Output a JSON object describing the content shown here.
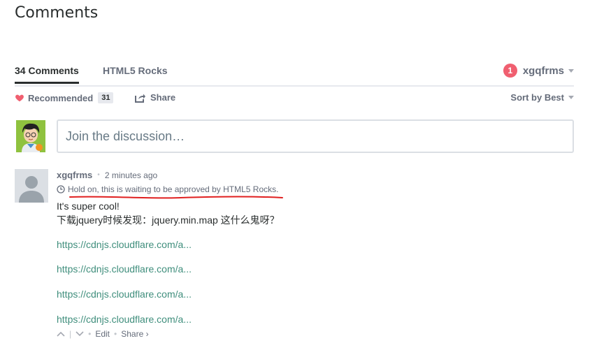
{
  "page": {
    "title": "Comments"
  },
  "nav": {
    "comments_tab": "34 Comments",
    "site_tab": "HTML5 Rocks",
    "notification_count": "1",
    "username": "xgqfrms"
  },
  "actions": {
    "recommend_label": "Recommended",
    "recommend_count": "31",
    "share_label": "Share",
    "sort_label": "Sort by Best"
  },
  "compose": {
    "placeholder": "Join the discussion…"
  },
  "comment": {
    "author": "xgqfrms",
    "time": "2 minutes ago",
    "pending_notice": "Hold on, this is waiting to be approved by HTML5 Rocks.",
    "line1": "It's super cool!",
    "line2": "下载jquery时候发现：jquery.min.map 这什么鬼呀？",
    "links": [
      "https://cdnjs.cloudflare.com/a...",
      "https://cdnjs.cloudflare.com/a...",
      "https://cdnjs.cloudflare.com/a...",
      "https://cdnjs.cloudflare.com/a..."
    ],
    "footer": {
      "edit_label": "Edit",
      "share_label": "Share ›"
    }
  },
  "colors": {
    "accent_green": "#3f8e7c",
    "notification_red": "#f05f70",
    "annotation_red": "#e01f1f"
  }
}
